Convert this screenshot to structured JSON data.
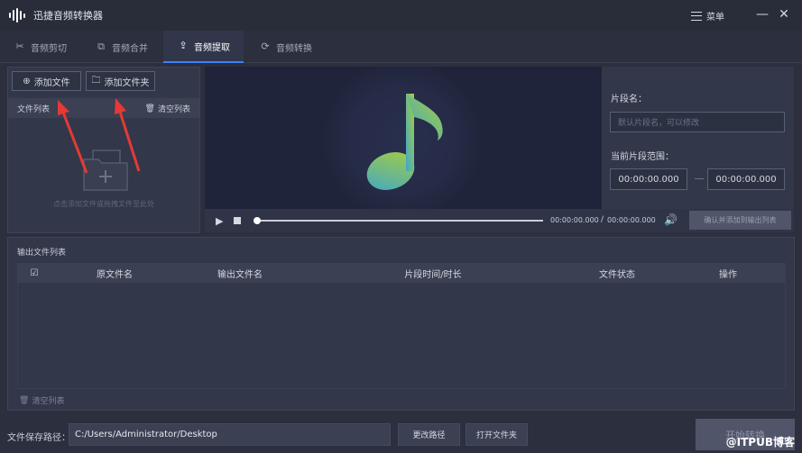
{
  "app": {
    "title": "迅捷音频转换器",
    "menu_label": "菜单"
  },
  "tabs": [
    {
      "label": "音频剪切",
      "icon": "scissors-icon"
    },
    {
      "label": "音频合并",
      "icon": "merge-icon"
    },
    {
      "label": "音频提取",
      "icon": "extract-icon",
      "active": true
    },
    {
      "label": "音频转换",
      "icon": "convert-icon"
    }
  ],
  "file_panel": {
    "add_file": "添加文件",
    "add_folder": "添加文件夹",
    "list_title": "文件列表",
    "clear_list": "清空列表",
    "empty_hint": "点击添加文件或拖拽文件至此处"
  },
  "player": {
    "current_time": "00:00:00.000",
    "separator": "/",
    "total_time": "00:00:00.000",
    "confirm_add": "确认并添加到输出列表"
  },
  "segment": {
    "name_label": "片段名：",
    "name_placeholder": "默认片段名，可以修改",
    "range_label": "当前片段范围：",
    "start_time": "00:00:00.000",
    "end_time": "00:00:00.000"
  },
  "output": {
    "title": "输出文件列表",
    "columns": [
      "原文件名",
      "输出文件名",
      "片段时间/时长",
      "文件状态",
      "操作"
    ],
    "clear_list": "清空列表"
  },
  "footer": {
    "save_path_label": "文件保存路径：",
    "save_path": "C:/Users/Administrator/Desktop",
    "change_path": "更改路径",
    "open_folder": "打开文件夹",
    "start": "开始转换"
  },
  "watermark": "@ITPUB博客",
  "colors": {
    "accent": "#3e80ff",
    "annotation_arrow": "#e53935",
    "note_gradient_start": "#3fa6c9",
    "note_gradient_end": "#a8cf3c"
  }
}
